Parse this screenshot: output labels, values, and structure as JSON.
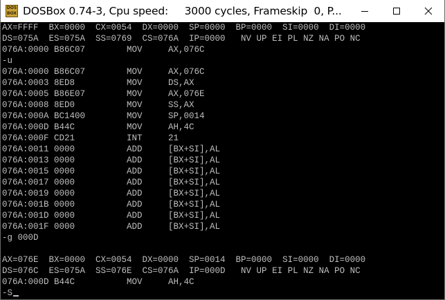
{
  "window": {
    "title": "DOSBox 0.74-3, Cpu speed:     3000 cycles, Frameskip  0, P...",
    "icon_label": [
      "DOS",
      "BOX"
    ],
    "icons": {
      "minimize": "minimize-icon",
      "maximize": "maximize-icon",
      "close": "close-icon"
    }
  },
  "console": {
    "lines": [
      "AX=FFFF  BX=0000  CX=0054  DX=0000  SP=0000  BP=0000  SI=0000  DI=0000",
      "DS=075A  ES=075A  SS=0769  CS=076A  IP=0000   NV UP EI PL NZ NA PO NC",
      "076A:0000 B86C07        MOV     AX,076C",
      "-u",
      "076A:0000 B86C07        MOV     AX,076C",
      "076A:0003 8ED8          MOV     DS,AX",
      "076A:0005 B86E07        MOV     AX,076E",
      "076A:0008 8ED0          MOV     SS,AX",
      "076A:000A BC1400        MOV     SP,0014",
      "076A:000D B44C          MOV     AH,4C",
      "076A:000F CD21          INT     21",
      "076A:0011 0000          ADD     [BX+SI],AL",
      "076A:0013 0000          ADD     [BX+SI],AL",
      "076A:0015 0000          ADD     [BX+SI],AL",
      "076A:0017 0000          ADD     [BX+SI],AL",
      "076A:0019 0000          ADD     [BX+SI],AL",
      "076A:001B 0000          ADD     [BX+SI],AL",
      "076A:001D 0000          ADD     [BX+SI],AL",
      "076A:001F 0000          ADD     [BX+SI],AL",
      "-g 000D",
      "",
      "AX=076E  BX=0000  CX=0054  DX=0000  SP=0014  BP=0000  SI=0000  DI=0000",
      "DS=076C  ES=075A  SS=076E  CS=076A  IP=000D   NV UP EI PL NZ NA PO NC",
      "076A:000D B44C          MOV     AH,4C",
      "-S"
    ],
    "text_color": "#bfbfbf",
    "background": "#000000"
  }
}
